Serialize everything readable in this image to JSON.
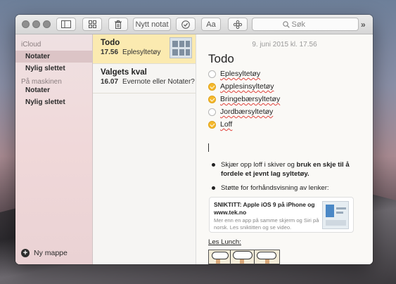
{
  "toolbar": {
    "new_note_label": "Nytt notat",
    "format_label": "Aa",
    "search_placeholder": "Søk",
    "overflow_label": "»"
  },
  "sidebar": {
    "sections": [
      {
        "title": "iCloud",
        "items": [
          {
            "label": "Notater",
            "selected": true
          },
          {
            "label": "Nylig slettet",
            "selected": false
          }
        ]
      },
      {
        "title": "På maskinen",
        "items": [
          {
            "label": "Notater",
            "selected": false
          },
          {
            "label": "Nylig slettet",
            "selected": false
          }
        ]
      }
    ],
    "new_folder_label": "Ny mappe"
  },
  "notes": [
    {
      "title": "Todo",
      "time": "17.56",
      "preview": "Eplesyltetøy",
      "selected": true
    },
    {
      "title": "Valgets kval",
      "time": "16.07",
      "preview": "Evernote eller Notater?",
      "selected": false
    }
  ],
  "editor": {
    "date": "9. juni 2015 kl. 17.56",
    "title": "Todo",
    "checklist": [
      {
        "text": "Eplesyltetøy",
        "checked": false
      },
      {
        "text": "Applesinsyltetøy",
        "checked": true
      },
      {
        "text": "Bringebærsyltetøy",
        "checked": true
      },
      {
        "text": "Jordbærsyltetøy",
        "checked": false
      },
      {
        "text": "Loff",
        "checked": true
      }
    ],
    "bullet1_part1": "Skjær opp loff i skiver og ",
    "bullet1_bold": "bruk en skje til å fordele et jevnt lag syltetøy.",
    "bullet2": "Støtte for forhåndsvisning av lenker:",
    "link_title": "SNIKTITT: Apple iOS 9 på iPhone og www.tek.no",
    "link_desc": "Mer enn en app på samme skjerm og Siri på norsk. Les sniktitten og se video.",
    "link2_label": "Les Lunch:"
  },
  "colors": {
    "selection_yellow": "#fbeab0",
    "checkbox_on": "#f5b92c",
    "sidebar_selected": "#dcc4c6"
  }
}
